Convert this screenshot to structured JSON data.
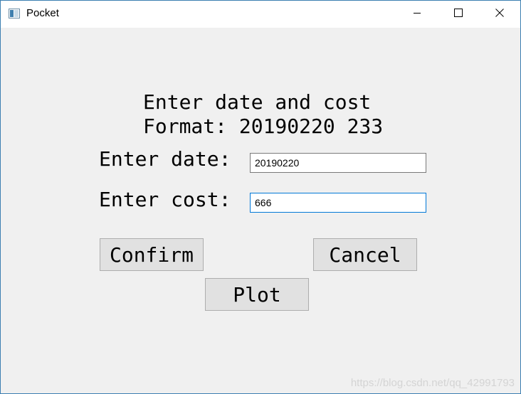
{
  "window": {
    "title": "Pocket"
  },
  "form": {
    "heading_line1": "Enter date and cost",
    "heading_line2": "Format: 20190220 233",
    "date_label": "Enter date:",
    "date_value": "20190220",
    "cost_label": "Enter cost:",
    "cost_value": "666"
  },
  "buttons": {
    "confirm": "Confirm",
    "cancel": "Cancel",
    "plot": "Plot"
  },
  "watermark": "https://blog.csdn.net/qq_42991793",
  "colors": {
    "background": "#f0f0f0",
    "button": "#e1e1e1",
    "focus_border": "#0078d7"
  },
  "icons": {
    "app": "app-window-icon",
    "minimize": "minimize-icon",
    "maximize": "maximize-icon",
    "close": "close-icon"
  }
}
